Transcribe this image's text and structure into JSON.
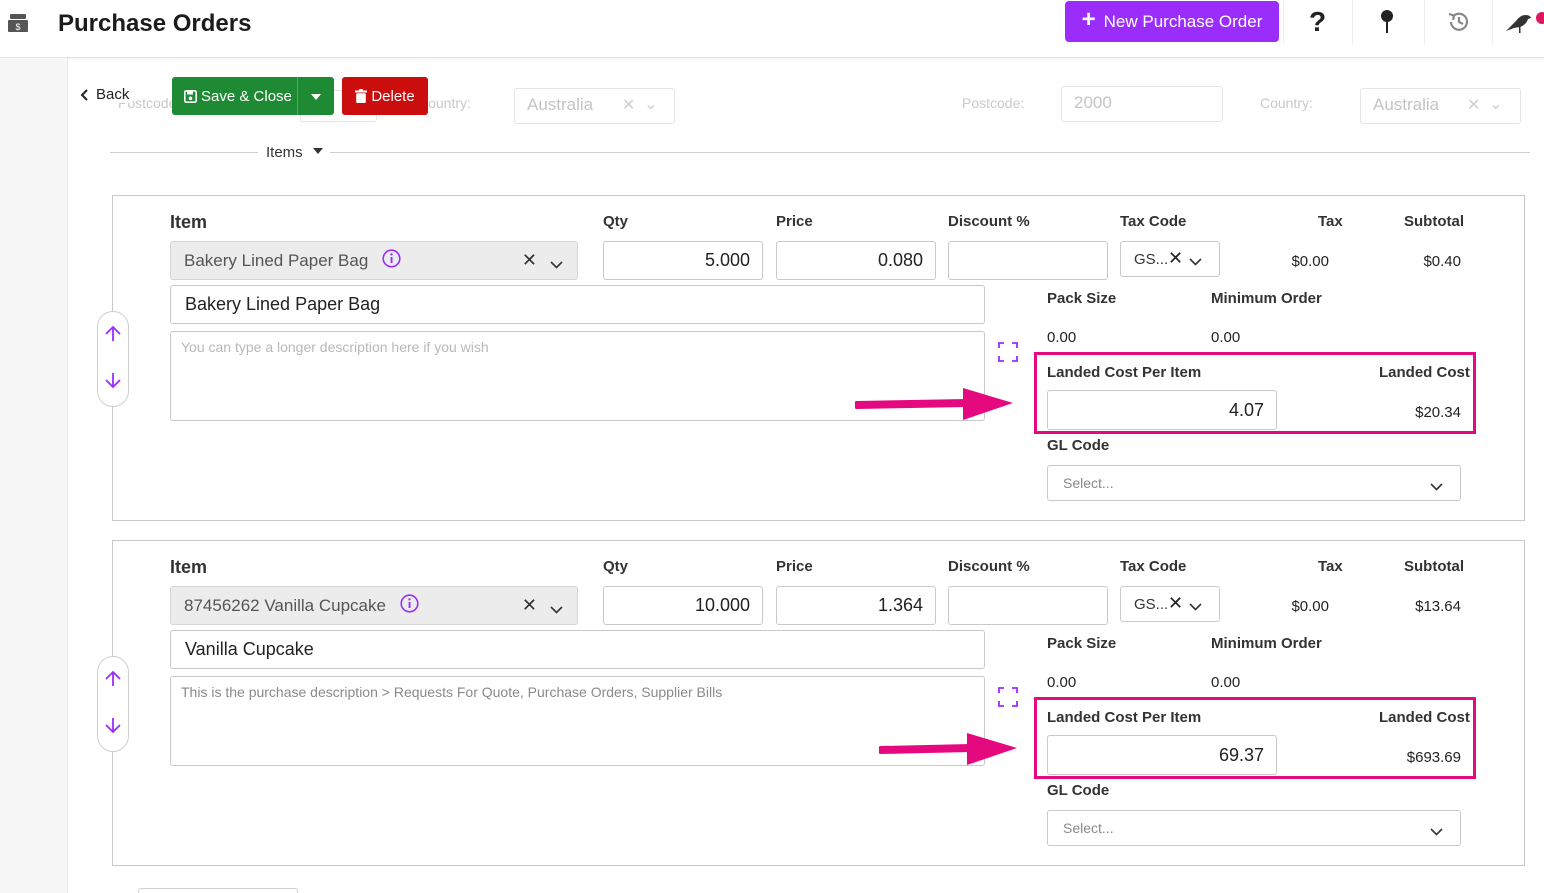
{
  "header": {
    "title": "Purchase Orders",
    "new_button_label": "New Purchase Order",
    "help_label": "?"
  },
  "action_bar": {
    "back_label": "Back",
    "save_label": "Save & Close",
    "delete_label": "Delete"
  },
  "background_form": {
    "postcode_label_left": "Postcode:",
    "country_label_left": "Country:",
    "country_value_left": "Australia",
    "postcode_label_right": "Postcode:",
    "postcode_value_right": "2000",
    "country_label_right": "Country:",
    "country_value_right": "Australia",
    "clear_glyph": "✕"
  },
  "items_section": {
    "title": "Items"
  },
  "labels": {
    "item": "Item",
    "qty": "Qty",
    "price": "Price",
    "discount": "Discount %",
    "tax_code": "Tax Code",
    "tax": "Tax",
    "subtotal": "Subtotal",
    "pack_size": "Pack Size",
    "minimum_order": "Minimum Order",
    "landed_cost_per_item": "Landed Cost Per Item",
    "landed_cost": "Landed Cost",
    "gl_code": "GL Code",
    "gl_placeholder": "Select...",
    "clear_glyph": "✕"
  },
  "items": [
    {
      "item_select": "Bakery Lined Paper Bag",
      "qty": "5.000",
      "price": "0.080",
      "discount": "",
      "tax_code": "GS...",
      "tax": "$0.00",
      "subtotal": "$0.40",
      "name": "Bakery Lined Paper Bag",
      "description": "You can type a longer description here if you wish",
      "pack_size": "0.00",
      "minimum_order": "0.00",
      "landed_cost_per_item": "4.07",
      "landed_cost": "$20.34"
    },
    {
      "item_select": "87456262 Vanilla Cupcake",
      "qty": "10.000",
      "price": "1.364",
      "discount": "",
      "tax_code": "GS...",
      "tax": "$0.00",
      "subtotal": "$13.64",
      "name": "Vanilla Cupcake",
      "description": "This is the purchase description > Requests For Quote, Purchase Orders, Supplier Bills",
      "pack_size": "0.00",
      "minimum_order": "0.00",
      "landed_cost_per_item": "69.37",
      "landed_cost": "$693.69"
    }
  ],
  "colors": {
    "primary_purple": "#9b2dfb",
    "save_green": "#1e8a34",
    "delete_red": "#cc0d0d",
    "highlight_pink": "#e5097f"
  },
  "icons": {
    "app": "cash-register-icon",
    "help": "help-icon",
    "pin": "pin-icon",
    "history": "history-icon",
    "bird": "bird-icon",
    "info": "info-icon",
    "expand": "expand-icon",
    "arrow": "pointer-arrow-icon"
  }
}
